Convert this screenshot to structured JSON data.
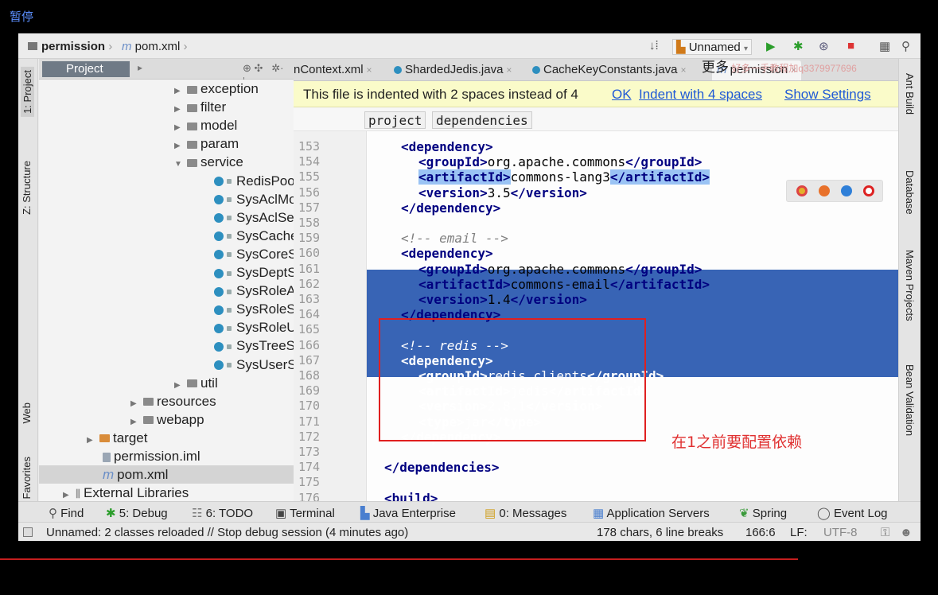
{
  "overlay": {
    "pause_label": "暂停",
    "watermark_prefix": "更多",
    "watermark_text": "好多一手教程加q3379977696",
    "annotation": "在1之前要配置依赖"
  },
  "navbar": {
    "project": "permission",
    "file": "pom.xml",
    "run_config": "Unnamed"
  },
  "left_tools": {
    "project": "1: Project",
    "structure": "Z: Structure",
    "web": "Web",
    "favorites": "2: Favorites"
  },
  "right_tools": {
    "ant": "Ant Build",
    "database": "Database",
    "maven": "Maven Projects",
    "bean": "Bean Validation"
  },
  "project_panel": {
    "title": "Project"
  },
  "tree": [
    {
      "label": "exception",
      "kind": "folder"
    },
    {
      "label": "filter",
      "kind": "folder"
    },
    {
      "label": "model",
      "kind": "folder"
    },
    {
      "label": "param",
      "kind": "folder"
    },
    {
      "label": "service",
      "kind": "folder-open"
    },
    {
      "label": "RedisPool",
      "kind": "class"
    },
    {
      "label": "SysAclMod",
      "kind": "class"
    },
    {
      "label": "SysAclServ",
      "kind": "class"
    },
    {
      "label": "SysCacheS",
      "kind": "class"
    },
    {
      "label": "SysCoreSe",
      "kind": "class"
    },
    {
      "label": "SysDeptSe",
      "kind": "class"
    },
    {
      "label": "SysRoleAcl",
      "kind": "class"
    },
    {
      "label": "SysRoleSer",
      "kind": "class"
    },
    {
      "label": "SysRoleUs",
      "kind": "class"
    },
    {
      "label": "SysTreeSe",
      "kind": "class"
    },
    {
      "label": "SysUserSe",
      "kind": "class"
    },
    {
      "label": "util",
      "kind": "folder"
    },
    {
      "label": "resources",
      "kind": "folder"
    },
    {
      "label": "webapp",
      "kind": "folder"
    },
    {
      "label": "target",
      "kind": "folder-orange"
    },
    {
      "label": "permission.iml",
      "kind": "file"
    },
    {
      "label": "pom.xml",
      "kind": "file-selected"
    },
    {
      "label": "External Libraries",
      "kind": "lib"
    }
  ],
  "editor_tabs": [
    "nContext.xml",
    "ShardedJedis.java",
    "CacheKeyConstants.java",
    "permission"
  ],
  "banner": {
    "message": "This file is indented with 2 spaces instead of 4",
    "ok": "OK",
    "indent4": "Indent with 4 spaces",
    "settings": "Show Settings"
  },
  "editor_breadcrumbs": [
    "project",
    "dependencies"
  ],
  "code": [
    {
      "n": "153",
      "text": "<dependency>"
    },
    {
      "n": "154",
      "text": "<groupId>org.apache.commons</groupId>"
    },
    {
      "n": "155",
      "text": "<artifactId>commons-lang3</artifactId>"
    },
    {
      "n": "156",
      "text": "<version>3.5</version>"
    },
    {
      "n": "157",
      "text": "</dependency>"
    },
    {
      "n": "158",
      "text": ""
    },
    {
      "n": "159",
      "text": "<!-- email -->"
    },
    {
      "n": "160",
      "text": "<dependency>"
    },
    {
      "n": "161",
      "text": "<groupId>org.apache.commons</groupId>"
    },
    {
      "n": "162",
      "text": "<artifactId>commons-email</artifactId>"
    },
    {
      "n": "163",
      "text": "<version>1.4</version>"
    },
    {
      "n": "164",
      "text": "</dependency>"
    },
    {
      "n": "165",
      "text": ""
    },
    {
      "n": "166",
      "text": "<!-- redis -->"
    },
    {
      "n": "167",
      "text": "<dependency>"
    },
    {
      "n": "168",
      "text": "<groupId>redis.clients</groupId>"
    },
    {
      "n": "169",
      "text": "<artifactId>jedis</artifactId>"
    },
    {
      "n": "170",
      "text": "<version>2.8.1</version>"
    },
    {
      "n": "171",
      "text": "<type>jar</type>"
    },
    {
      "n": "172",
      "text": "</dependency>"
    },
    {
      "n": "173",
      "text": ""
    },
    {
      "n": "174",
      "text": "</dependencies>"
    },
    {
      "n": "175",
      "text": ""
    },
    {
      "n": "176",
      "text": "<build>"
    }
  ],
  "toolwindows": {
    "find": "Find",
    "debug": "5: Debug",
    "todo": "6: TODO",
    "terminal": "Terminal",
    "javaee": "Java Enterprise",
    "messages": "0: Messages",
    "appservers": "Application Servers",
    "spring": "Spring",
    "eventlog": "Event Log"
  },
  "status": {
    "message": "Unnamed: 2 classes reloaded // Stop debug session (4 minutes ago)",
    "chars": "178 chars, 6 line breaks",
    "position": "166:6",
    "lf": "LF:",
    "encoding": "UTF-8"
  }
}
